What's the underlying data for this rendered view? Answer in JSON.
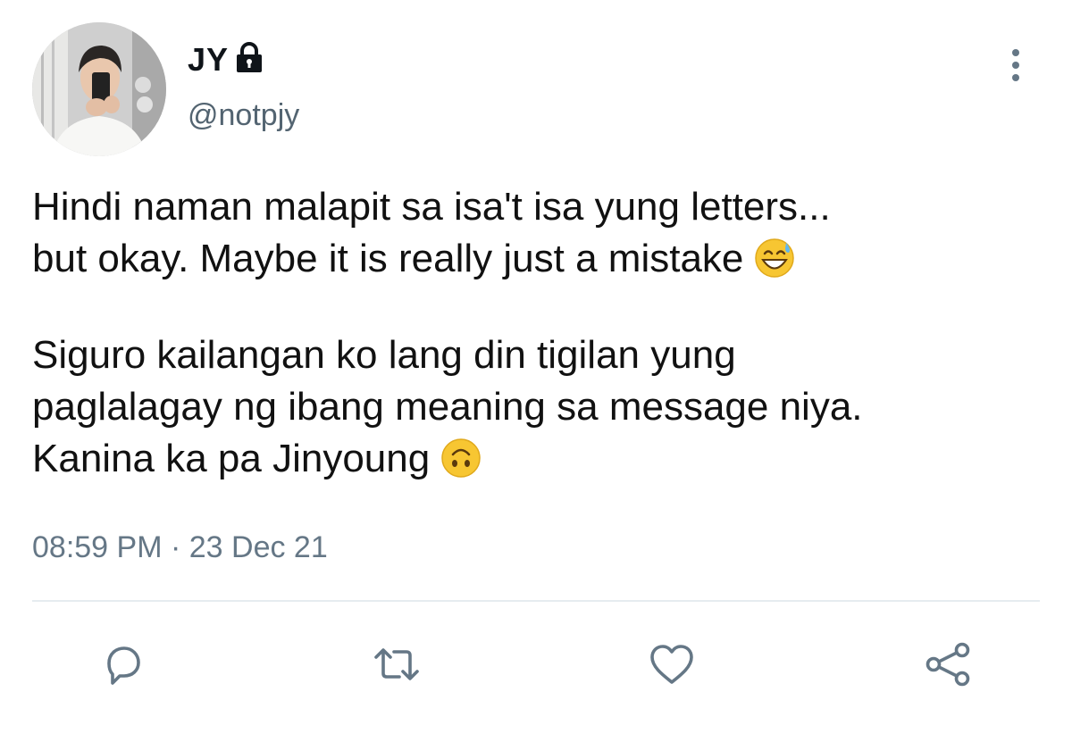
{
  "tweet": {
    "display_name": "JY",
    "handle": "@notpjy",
    "body": [
      {
        "lines": [
          "Hindi naman malapit sa isa't isa yung letters...",
          "but okay. Maybe it is really just a mistake"
        ],
        "trailing_emoji": "grinning-face-with-sweat"
      },
      {
        "lines": [
          "Siguro kailangan ko lang din tigilan yung",
          "paglalagay ng ibang meaning sa message niya.",
          "Kanina ka pa Jinyoung"
        ],
        "trailing_emoji": "upside-down-face"
      }
    ],
    "time": "08:59 PM",
    "separator": " · ",
    "date": "23 Dec 21"
  },
  "icons": {
    "verified_lock": "lock-icon",
    "menu": "more-vertical-icon",
    "actions": [
      "reply-icon",
      "retweet-icon",
      "like-icon",
      "share-icon"
    ]
  },
  "colors": {
    "text": "#0f1419",
    "secondary": "#657786",
    "icon": "#657786",
    "divider": "#e6ecf0"
  }
}
